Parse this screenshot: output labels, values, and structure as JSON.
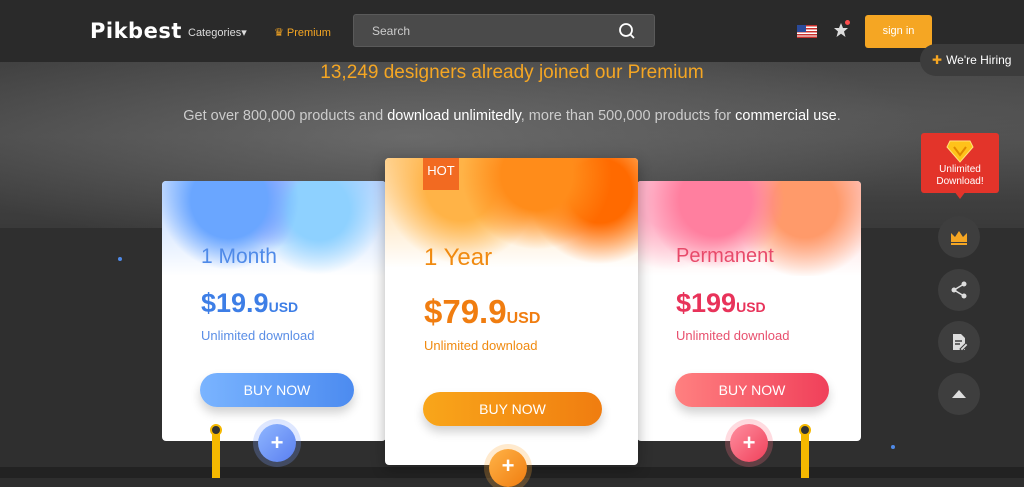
{
  "header": {
    "logo": "Pikbest",
    "categories_label": "Categories",
    "premium_label": "Premium",
    "search_placeholder": "Search",
    "signin_label": "sign in"
  },
  "hiring_label": "We're Hiring",
  "hero": {
    "headline": "13,249 designers already joined our Premium",
    "sub_part1": "Get over 800,000 products and ",
    "sub_bold1": "download unlimitedly",
    "sub_part2": ", more than 500,000 products for ",
    "sub_bold2": "commercial use",
    "sub_part3": "."
  },
  "plans": [
    {
      "title": "1 Month",
      "price": "$19.9",
      "currency": "USD",
      "feature": "Unlimited download",
      "button": "BUY NOW",
      "color": "#4f8ae8"
    },
    {
      "title": "1 Year",
      "badge": "HOT",
      "price": "$79.9",
      "currency": "USD",
      "feature": "Unlimited download",
      "button": "BUY NOW",
      "color": "#f07d10"
    },
    {
      "title": "Permanent",
      "price": "$199",
      "currency": "USD",
      "feature": "Unlimited download",
      "button": "BUY NOW",
      "color": "#e8335a"
    }
  ],
  "rail": {
    "unlimited_label_line1": "Unlimited",
    "unlimited_label_line2": "Download!"
  },
  "icons": [
    "search-icon",
    "us-flag-icon",
    "star-icon",
    "crown-icon",
    "share-icon",
    "document-edit-icon",
    "arrow-up-icon",
    "diamond-icon",
    "plus-icon"
  ]
}
